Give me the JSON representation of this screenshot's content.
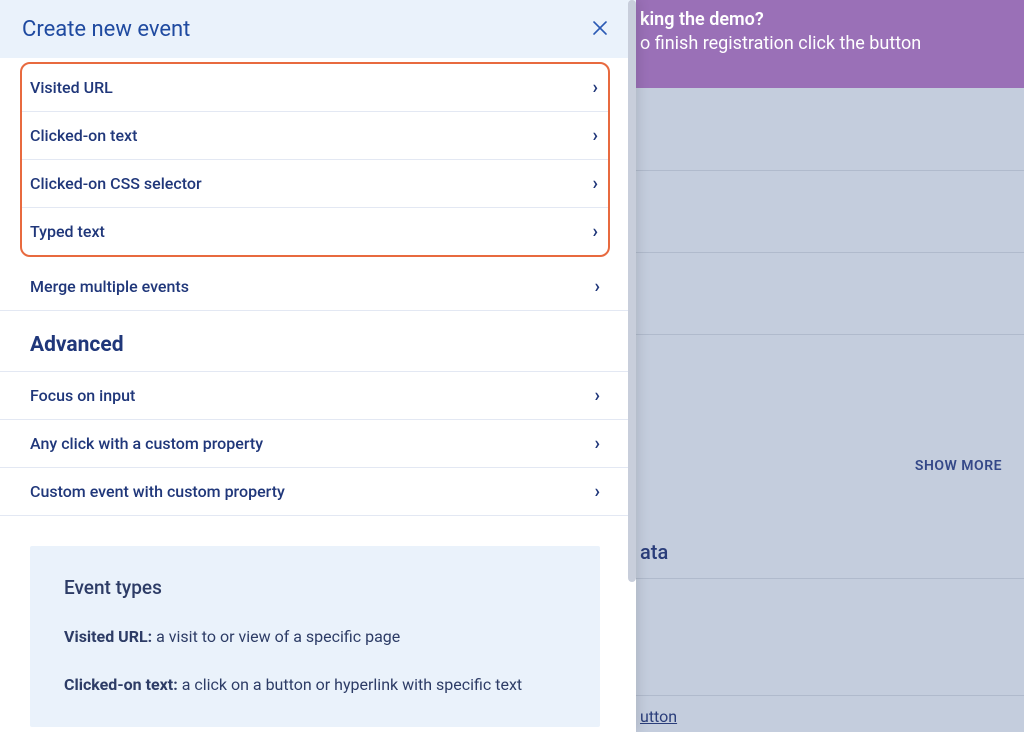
{
  "background": {
    "banner_line1": "king the demo?",
    "banner_line2": "o finish registration click the button",
    "showmore_label": "SHOW MORE",
    "section_title": "ata",
    "bottom_link": "utton"
  },
  "modal": {
    "title": "Create new event",
    "basic_items": [
      {
        "label": "Visited URL"
      },
      {
        "label": "Clicked-on text"
      },
      {
        "label": "Clicked-on CSS selector"
      },
      {
        "label": "Typed text"
      }
    ],
    "merge_label": "Merge multiple events",
    "advanced_heading": "Advanced",
    "advanced_items": [
      {
        "label": "Focus on input"
      },
      {
        "label": "Any click with a custom property"
      },
      {
        "label": "Custom event with custom property"
      }
    ],
    "info": {
      "heading": "Event types",
      "visited_url_term": "Visited URL:",
      "visited_url_desc": "a visit to or view of a specific page",
      "clicked_text_term": "Clicked-on text:",
      "clicked_text_desc": "a click on a button or hyperlink with specific text"
    }
  }
}
